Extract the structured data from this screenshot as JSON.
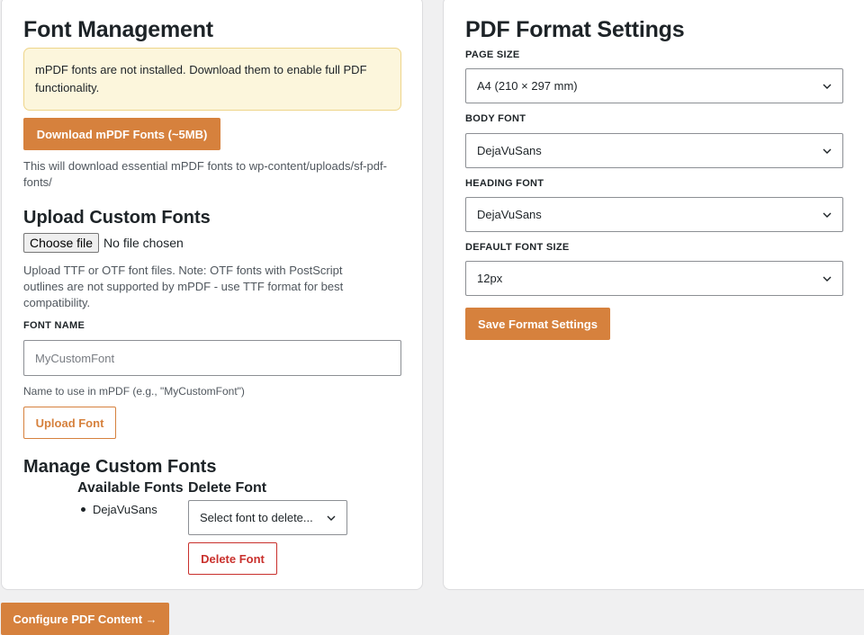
{
  "font_management": {
    "title": "Font Management",
    "notice": "mPDF fonts are not installed. Download them to enable full PDF functionality.",
    "download_button": "Download mPDF Fonts (~5MB)",
    "download_desc": "This will download essential mPDF fonts to wp-content/uploads/sf-pdf-fonts/",
    "upload_title": "Upload Custom Fonts",
    "choose_file_label": "Choose file",
    "no_file_text": "No file chosen",
    "upload_desc": "Upload TTF or OTF font files. Note: OTF fonts with PostScript outlines are not supported by mPDF - use TTF format for best compatibility.",
    "font_name_label": "FONT NAME",
    "font_name_placeholder": "MyCustomFont",
    "font_name_value": "",
    "font_name_help": "Name to use in mPDF (e.g., \"MyCustomFont\")",
    "upload_button": "Upload Font",
    "manage_title": "Manage Custom Fonts",
    "available_fonts_heading": "Available Fonts",
    "available_fonts": [
      "DejaVuSans"
    ],
    "delete_font_heading": "Delete Font",
    "delete_select_value": "Select font to delete...",
    "delete_button": "Delete Font"
  },
  "pdf_format": {
    "title": "PDF Format Settings",
    "page_size_label": "PAGE SIZE",
    "page_size_value": "A4 (210 × 297 mm)",
    "body_font_label": "BODY FONT",
    "body_font_value": "DejaVuSans",
    "heading_font_label": "HEADING FONT",
    "heading_font_value": "DejaVuSans",
    "font_size_label": "DEFAULT FONT SIZE",
    "font_size_value": "12px",
    "save_button": "Save Format Settings"
  },
  "footer": {
    "configure_button": "Configure PDF Content →"
  },
  "colors": {
    "accent": "#d6813d",
    "danger": "#c9302c",
    "notice_bg": "#fcf6dc",
    "page_bg": "#f0f0f1"
  },
  "icons": {
    "select_arrow": "chevron-down-icon"
  }
}
